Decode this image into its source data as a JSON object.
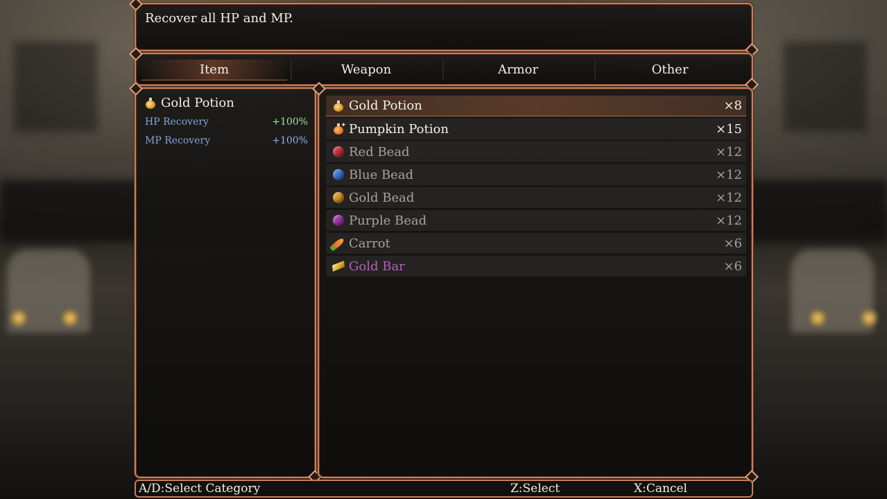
{
  "help": {
    "text": "Recover all HP and MP."
  },
  "tabs": [
    {
      "label": "Item",
      "active": true
    },
    {
      "label": "Weapon",
      "active": false
    },
    {
      "label": "Armor",
      "active": false
    },
    {
      "label": "Other",
      "active": false
    }
  ],
  "detail": {
    "name": "Gold Potion",
    "icon": "gold-potion-icon",
    "stats": [
      {
        "label": "HP Recovery",
        "value": "+100%"
      },
      {
        "label": "MP Recovery",
        "value": "+100%"
      }
    ]
  },
  "items": [
    {
      "name": "Gold Potion",
      "qty": "×8",
      "icon": "gold-potion-icon"
    },
    {
      "name": "Pumpkin Potion",
      "qty": "×15",
      "icon": "pumpkin-potion-icon"
    },
    {
      "name": "Red Bead",
      "qty": "×12",
      "icon": "red-bead-icon",
      "color": "#c8323c"
    },
    {
      "name": "Blue Bead",
      "qty": "×12",
      "icon": "blue-bead-icon",
      "color": "#3a78d8"
    },
    {
      "name": "Gold Bead",
      "qty": "×12",
      "icon": "gold-bead-icon",
      "color": "#d8962a"
    },
    {
      "name": "Purple Bead",
      "qty": "×12",
      "icon": "purple-bead-icon",
      "color": "#a234b0"
    },
    {
      "name": "Carrot",
      "qty": "×6",
      "icon": "carrot-icon"
    },
    {
      "name": "Gold Bar",
      "qty": "×6",
      "icon": "gold-bar-icon"
    }
  ],
  "keys": {
    "category": "A/D:Select Category",
    "select": "Z:Select",
    "cancel": "X:Cancel"
  }
}
